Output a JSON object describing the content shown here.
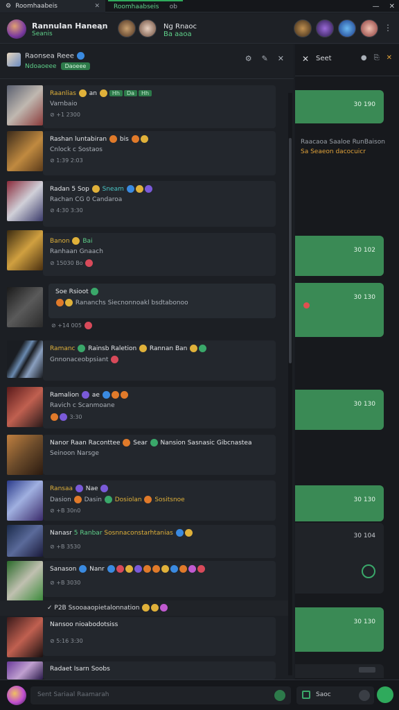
{
  "tabs": [
    {
      "label": "Roomhaabeis"
    },
    {
      "label": "Roomhaabseis",
      "extra": "ob"
    }
  ],
  "header": {
    "name": "Rannulan Hanean",
    "sub": "Seanis",
    "group_label": "Ng Rnaoc",
    "group_sub": "Ba aaoa"
  },
  "left_head": {
    "title": "Raonsea Reee",
    "sub": "Ndoaoeee",
    "badge": "Daoeee"
  },
  "messages": [
    {
      "l1": "Raanlias",
      "l1b": "an",
      "chips": [
        "Hh",
        "Da",
        "Hh"
      ],
      "l2": "Varnbaio",
      "l3": "+1 2300"
    },
    {
      "l1": "Rashan luntabiran",
      "l1b": "bis",
      "l2": "Cnlock c Sostaos",
      "l3": "1:39 2:03"
    },
    {
      "l1": "Radan 5 Sop",
      "l1b": "Sneam",
      "l2": "Rachan CG 0 Candaroa",
      "l3": "4:30 3:30"
    },
    {
      "l1": "Banon",
      "l1b": "Bai",
      "l2": "Ranhaan Gnaach",
      "l3": "15030 Bo"
    },
    {
      "l1": "Soe Rsioot",
      "l2": "Rananchs Siecnonnoakl bsdtabonoo",
      "l3": "+14 005"
    },
    {
      "l1": "Ramanc",
      "l1b": "Rainsb Raletion",
      "l1c": "Rannan",
      "l1d": "Ban",
      "l2": "Gnnonaceobpsiant"
    },
    {
      "l1": "Ramalion",
      "l1b": "ae",
      "l2": "Ravich c Scanmoane",
      "l3": "3:30"
    },
    {
      "l1": "Nanor Raan Raconttee",
      "l1b": "Sear",
      "l1c": "Nansion Sasnasic Gibcnastea",
      "l2": "Seinoon Narsge"
    },
    {
      "l1": "Ransaa",
      "l1b": "Nae",
      "l2": "Dasion",
      "l2b": "Dasin",
      "l2c": "Dosiolan",
      "l2d": "Sositsnoe",
      "l3": "+B 30n0"
    },
    {
      "l1": "Nanasr",
      "l1b": "5 Ranbar",
      "l1c": "Sosnnaconstarhtanias",
      "l3": "+B 3530"
    },
    {
      "l1": "Sanason",
      "l1b": "Nanr",
      "l3": "+B 3030"
    },
    {
      "l1": "Nansoo",
      "l1b": "nioabodotsiss",
      "l3": "5:16 3:30"
    },
    {
      "l1": "Radaet Isarn Soobs"
    }
  ],
  "separator": "P2B Ssooaaopietalonnation",
  "right": {
    "title": "Seet",
    "note": "Raacaoa Saaloe RunBaison",
    "note2": "Sa Seaeon dacocuicr",
    "blocks": [
      "30 190",
      "30 102",
      "30 130",
      "30 130",
      "30 130",
      "30 130"
    ],
    "dark_value": "30 104"
  },
  "footer": {
    "placeholder": "Sent Sariaal Raamarah",
    "right_label": "Saoc"
  },
  "colors": {
    "accent": "#2faa5c",
    "highlight": "#e0b13a",
    "background": "#1a1d22"
  }
}
